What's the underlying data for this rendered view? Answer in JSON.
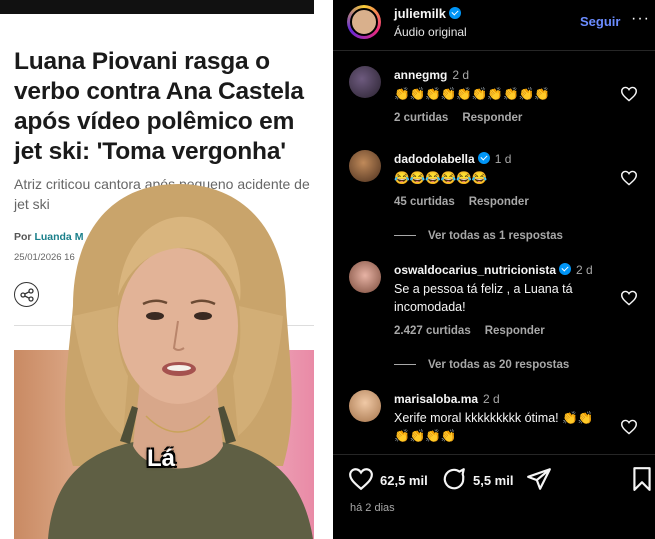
{
  "article": {
    "headline": "Luana Piovani rasga o verbo contra Ana Castela após vídeo polêmico em jet ski: 'Toma vergonha'",
    "subhead": "Atriz criticou cantora após pequeno acidente de jet ski",
    "by_prefix": "Por",
    "author": "Luanda M",
    "date": "25/01/2026 16",
    "caption": "Lá"
  },
  "header": {
    "username": "juliemilk",
    "audio": "Áudio original",
    "follow_label": "Seguir",
    "more_label": "···"
  },
  "comments": [
    {
      "user": "annegmg",
      "time": "2 d",
      "text": "👏👏👏👏👏👏👏👏👏👏",
      "likes": "2 curtidas",
      "reply": "Responder",
      "verified": false
    },
    {
      "user": "dadodolabella",
      "time": "1 d",
      "text": "😂😂😂😂😂😂",
      "likes": "45 curtidas",
      "reply": "Responder",
      "verified": true,
      "view_replies": "Ver todas as 1 respostas"
    },
    {
      "user": "oswaldocarius_nutricionista",
      "time": "2 d",
      "text": "Se a pessoa tá feliz , a Luana tá incomodada!",
      "likes": "2.427 curtidas",
      "reply": "Responder",
      "verified": true,
      "view_replies": "Ver todas as 20 respostas"
    },
    {
      "user": "marisaloba.ma",
      "time": "2 d",
      "text": "Xerife moral kkkkkkkkk ótima! 👏👏👏👏👏👏",
      "verified": false
    }
  ],
  "actions": {
    "likes": "62,5 mil",
    "comments": "5,5 mil"
  },
  "posted": "há 2 dias",
  "colors": {
    "background": "#000000",
    "accent_link": "#6b8cff",
    "verified": "#0095f6",
    "muted_text": "#a8a8a8"
  }
}
